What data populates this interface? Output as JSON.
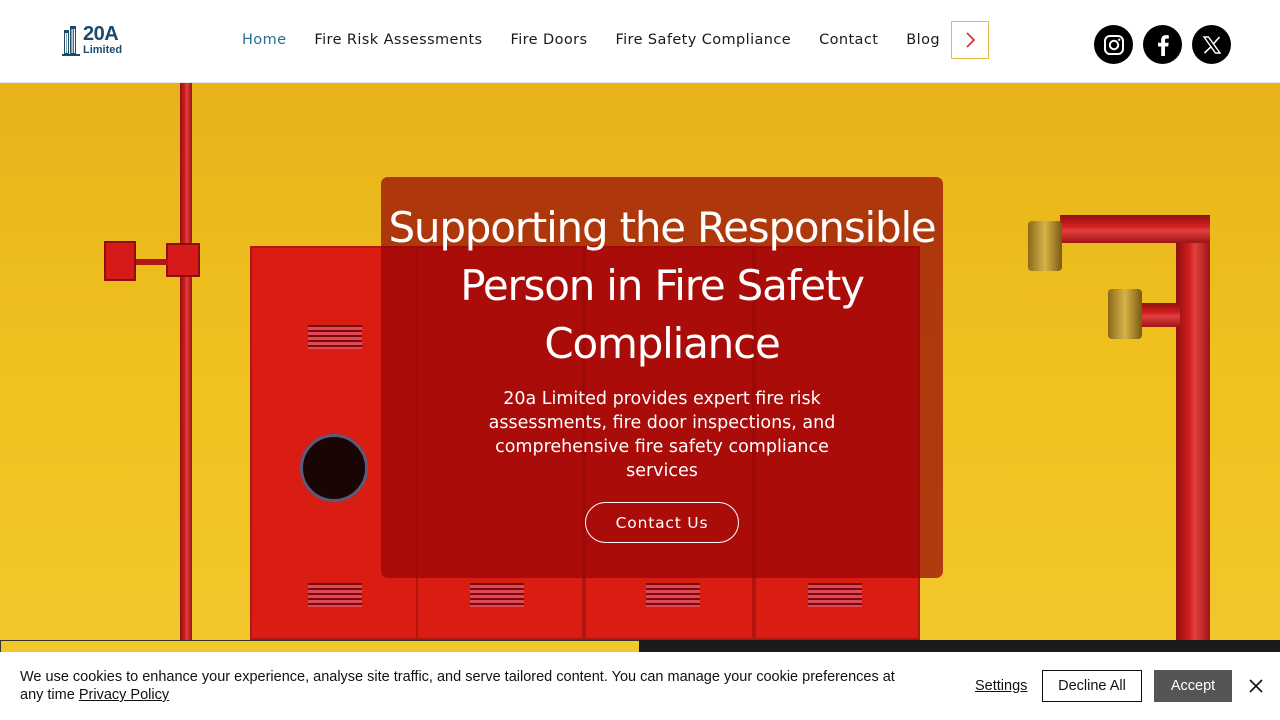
{
  "brand": {
    "logo_big": "20A",
    "logo_small": "Limited",
    "color": "#1b4a6b"
  },
  "nav": {
    "items": [
      {
        "label": "Home",
        "active": true
      },
      {
        "label": "Fire Risk Assessments",
        "active": false
      },
      {
        "label": "Fire Doors",
        "active": false
      },
      {
        "label": "Fire Safety Compliance",
        "active": false
      },
      {
        "label": "Contact",
        "active": false
      },
      {
        "label": "Blog",
        "active": false
      }
    ],
    "more_icon": "chevron-right-icon",
    "active_color": "#2a6f91"
  },
  "social": [
    {
      "name": "instagram",
      "icon": "instagram-icon"
    },
    {
      "name": "facebook",
      "icon": "facebook-icon"
    },
    {
      "name": "x",
      "icon": "x-icon"
    }
  ],
  "hero": {
    "title": "Supporting the Responsible Person in Fire Safety Compliance",
    "subtitle": "20a Limited provides expert fire risk assessments, fire door inspections, and comprehensive fire safety compliance services",
    "cta_label": "Contact Us",
    "bg_color": "#f0c21f",
    "overlay_color": "#960505"
  },
  "cookie": {
    "text": "We use cookies to enhance your experience, analyse site traffic, and serve tailored content. You can manage your cookie preferences at any time",
    "policy_link": "Privacy Policy",
    "settings_label": "Settings",
    "decline_label": "Decline All",
    "accept_label": "Accept"
  }
}
